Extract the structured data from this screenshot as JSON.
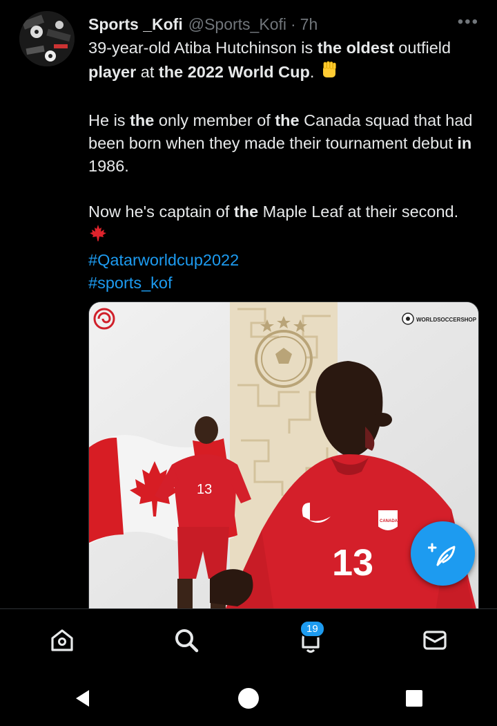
{
  "tweet": {
    "display_name": "Sports _Kofi",
    "handle": "@Sports_Kofi",
    "separator": "·",
    "time": "7h",
    "more": "•••",
    "line1_a": "39-year-old Atiba Hutchinson is ",
    "line1_b": "the oldest",
    "line1_c": " outfield ",
    "line1_d": "player",
    "line1_e": " at ",
    "line1_f": "the 2022 World Cup",
    "line1_g": ". ",
    "para2_a": "He is ",
    "para2_b": "the",
    "para2_c": " only member of ",
    "para2_d": "the",
    "para2_e": " Canada squad that had been born when they made their tournament debut ",
    "para2_f": "in",
    "para2_g": " 1986.",
    "para3_a": "Now he's captain of ",
    "para3_b": "the",
    "para3_c": " Maple Leaf at their second. ",
    "hashtags": [
      "#Qatarworldcup2022",
      "#sports_kof"
    ]
  },
  "media": {
    "brand": "WORLDSOCCERSHOP",
    "jersey_number": "13",
    "badge_text": "CANADA"
  },
  "nav": {
    "notification_count": "19"
  },
  "colors": {
    "accent": "#1d9bf0",
    "background": "#000000",
    "text": "#e7e9ea",
    "muted": "#71767b"
  }
}
